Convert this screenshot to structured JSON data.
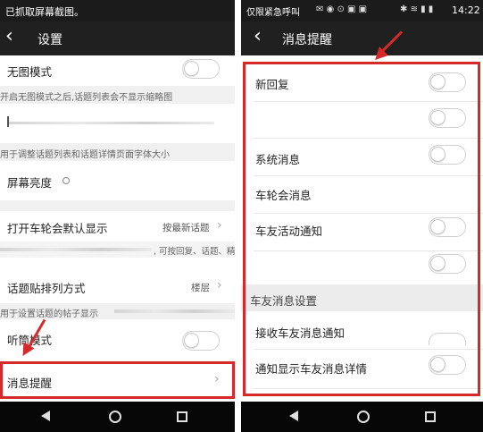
{
  "left": {
    "status_text": "已抓取屏幕截图。",
    "header_title": "设置",
    "rows": {
      "no_image_mode": "无图模式",
      "no_image_hint": "开启无图模式之后,话题列表会不显示缩略图",
      "font_hint": "用于调整话题列表和话题详情页面字体大小",
      "brightness": "屏幕亮度",
      "default_display": "打开车轮会默认显示",
      "default_display_value": "按最新话题",
      "default_display_hint": ", 可按回复、话题、精华",
      "sort_order": "话题贴排列方式",
      "sort_order_value": "楼层",
      "sort_order_hint": "用于设置话题的帖子显示",
      "earpiece_mode": "听筒模式",
      "message_reminder": "消息提醒"
    }
  },
  "right": {
    "status_text": "仅限紧急呼叫",
    "time": "14:22",
    "header_title": "消息提醒",
    "rows": {
      "new_reply": "新回复",
      "system_message": "系统消息",
      "chelunhui_message": "车轮会消息",
      "friend_activity": "车友活动通知",
      "section_title": "车友消息设置",
      "receive_friend_msg": "接收车友消息通知",
      "show_friend_msg_detail": "通知显示车友消息详情"
    }
  },
  "colors": {
    "highlight_red": "#d62a2a",
    "status_bar": "#1b1b1b",
    "app_bar": "#202020",
    "nav_bar": "#070707"
  },
  "icons": {
    "back": "chevron-left-icon",
    "brightness": "sun-icon",
    "chevron": "chevron-right-icon",
    "nav_back": "triangle-back-icon",
    "nav_home": "circle-home-icon",
    "nav_recent": "square-recent-icon"
  }
}
